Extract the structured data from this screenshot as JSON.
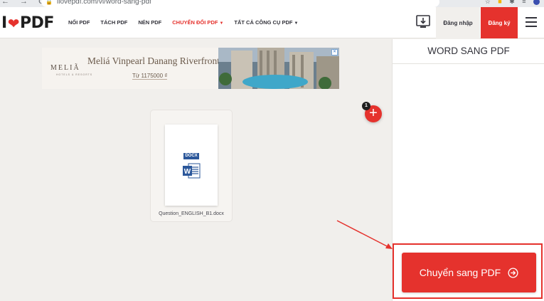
{
  "browser": {
    "url": "ilovepdf.com/vi/word-sang-pdf"
  },
  "navbar": {
    "logo_prefix": "I",
    "logo_suffix": "PDF",
    "menu": [
      {
        "label": "NỐI PDF"
      },
      {
        "label": "TÁCH PDF"
      },
      {
        "label": "NÉN PDF"
      },
      {
        "label": "CHUYỂN ĐỔI PDF",
        "active": true
      },
      {
        "label": "TẤT CẢ CÔNG CỤ PDF"
      }
    ],
    "login_label": "Đăng nhập",
    "signup_label": "Đăng ký"
  },
  "ad": {
    "brand": "MELIÃ",
    "brand_sub": "HOTELS & RESORTS",
    "headline": "Meliá Vinpearl Danang Riverfront",
    "price": "Từ 1175000 ₫"
  },
  "file": {
    "badge": "DOCX",
    "name": "Question_ENGLISH_B1.docx"
  },
  "add_button": {
    "count": "1"
  },
  "sidebar": {
    "title": "WORD SANG PDF",
    "convert_label": "Chuyển sang PDF"
  },
  "colors": {
    "brand_red": "#e5322d",
    "word_blue": "#2b579a",
    "background": "#f1efec"
  }
}
